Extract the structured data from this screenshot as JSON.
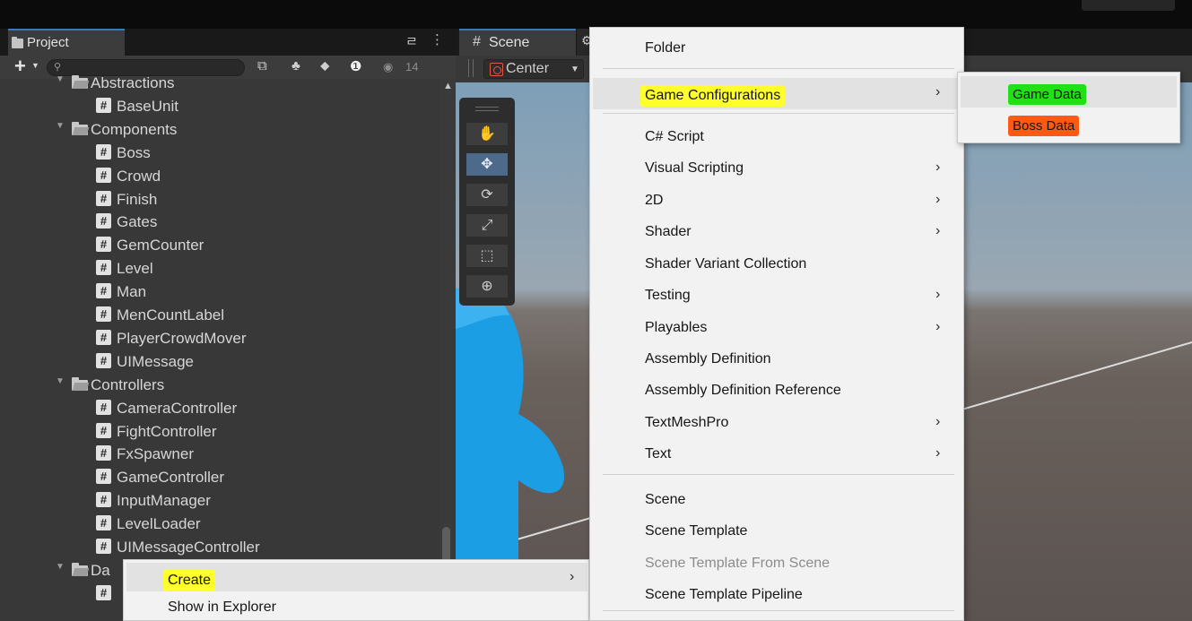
{
  "project_panel": {
    "tab_label": "Project",
    "hidden_count": "14",
    "tree": [
      {
        "type": "folder",
        "label": "Abstractions"
      },
      {
        "type": "script",
        "label": "BaseUnit"
      },
      {
        "type": "folder",
        "label": "Components"
      },
      {
        "type": "script",
        "label": "Boss"
      },
      {
        "type": "script",
        "label": "Crowd"
      },
      {
        "type": "script",
        "label": "Finish"
      },
      {
        "type": "script",
        "label": "Gates"
      },
      {
        "type": "script",
        "label": "GemCounter"
      },
      {
        "type": "script",
        "label": "Level"
      },
      {
        "type": "script",
        "label": "Man"
      },
      {
        "type": "script",
        "label": "MenCountLabel"
      },
      {
        "type": "script",
        "label": "PlayerCrowdMover"
      },
      {
        "type": "script",
        "label": "UIMessage"
      },
      {
        "type": "folder",
        "label": "Controllers"
      },
      {
        "type": "script",
        "label": "CameraController"
      },
      {
        "type": "script",
        "label": "FightController"
      },
      {
        "type": "script",
        "label": "FxSpawner"
      },
      {
        "type": "script",
        "label": "GameController"
      },
      {
        "type": "script",
        "label": "InputManager"
      },
      {
        "type": "script",
        "label": "LevelLoader"
      },
      {
        "type": "script",
        "label": "UIMessageController"
      },
      {
        "type": "folder",
        "label": "Da"
      }
    ]
  },
  "scene_panel": {
    "tab_label": "Scene",
    "pivot_label": "Center"
  },
  "context_menu": {
    "items": [
      {
        "label": "Create",
        "submenu": true,
        "highlighted": true
      },
      {
        "label": "Show in Explorer",
        "submenu": false
      }
    ]
  },
  "create_submenu": {
    "items": [
      {
        "label": "Folder",
        "submenu": false
      },
      {
        "label": "Game Configurations",
        "submenu": true,
        "highlighted": true
      },
      {
        "label": "C# Script",
        "submenu": false
      },
      {
        "label": "Visual Scripting",
        "submenu": true
      },
      {
        "label": "2D",
        "submenu": true
      },
      {
        "label": "Shader",
        "submenu": true
      },
      {
        "label": "Shader Variant Collection",
        "submenu": false
      },
      {
        "label": "Testing",
        "submenu": true
      },
      {
        "label": "Playables",
        "submenu": true
      },
      {
        "label": "Assembly Definition",
        "submenu": false
      },
      {
        "label": "Assembly Definition Reference",
        "submenu": false
      },
      {
        "label": "TextMeshPro",
        "submenu": true
      },
      {
        "label": "Text",
        "submenu": true
      },
      {
        "label": "Scene",
        "submenu": false
      },
      {
        "label": "Scene Template",
        "submenu": false
      },
      {
        "label": "Scene Template From Scene",
        "submenu": false,
        "disabled": true
      },
      {
        "label": "Scene Template Pipeline",
        "submenu": false
      }
    ]
  },
  "game_config_submenu": {
    "items": [
      {
        "label": "Game Data",
        "highlight_color": "#22e018"
      },
      {
        "label": "Boss Data",
        "highlight_color": "#fa5a14"
      }
    ]
  },
  "colors": {
    "menu_highlight": "#ffff2e",
    "editor_bg": "#383838",
    "character_blue": "#1a9be0"
  }
}
